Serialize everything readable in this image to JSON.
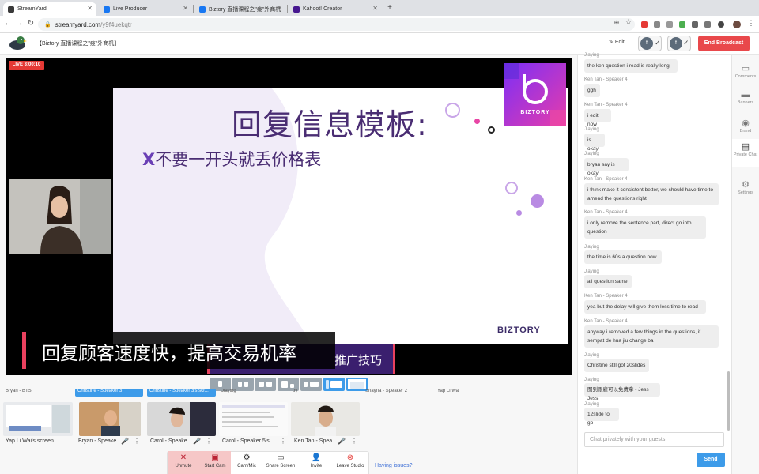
{
  "browser": {
    "tabs": [
      {
        "label": "StreamYard",
        "active": true,
        "color": "#3a3a3a"
      },
      {
        "label": "Live Producer",
        "active": false,
        "color": "#1877f2"
      },
      {
        "label": "Biztory 直播课程之\"疫\"外商机",
        "active": false,
        "color": "#1877f2"
      },
      {
        "label": "Kahoot! Creator",
        "active": false,
        "color": "#46178f"
      }
    ],
    "url_host": "streamyard.com",
    "url_path": "/y9f4uekqtr"
  },
  "app": {
    "title": "【Biztory 直播课程之\"疫\"外商机】",
    "edit_label": "Edit",
    "end_label": "End Broadcast",
    "accent": "#3d9be9",
    "end_color": "#e9484b"
  },
  "stage": {
    "live_label": "LIVE 3:00:10",
    "slide_title": "回复信息模板:",
    "slide_subtitle": "不要一开头就丢价格表",
    "slide_subtitle_mark": "X",
    "brand_name": "BIZTORY",
    "footer_brand": "BIZTORY",
    "caption_main": "回复顾客速度快，提高交易机率",
    "caption_sub": "推广技巧"
  },
  "backstage": {
    "names": [
      {
        "label": "Bryan - BTS",
        "onstage": false
      },
      {
        "label": "Christine - Speaker 3",
        "onstage": true
      },
      {
        "label": "Christine - Speaker 3's scr...",
        "onstage": true
      },
      {
        "label": "Jiaying",
        "onstage": false
      },
      {
        "label": "py",
        "onstage": false
      },
      {
        "label": "Shayna - Speaker 2",
        "onstage": false
      },
      {
        "label": "Yap Li Wai",
        "onstage": false
      }
    ],
    "thumbs": [
      {
        "label": "Yap Li Wai's screen"
      },
      {
        "label": "Bryan - Speake..."
      },
      {
        "label": "Carol - Speake..."
      },
      {
        "label": "Carol - Speaker 5's ..."
      },
      {
        "label": "Ken Tan - Spea..."
      }
    ]
  },
  "controls": {
    "unmute": "Unmute",
    "start_cam": "Start Cam",
    "cam_mic": "Cam/Mic",
    "share_screen": "Share Screen",
    "invite": "Invite",
    "leave": "Leave Studio",
    "issues": "Having issues?"
  },
  "chat": {
    "messages": [
      {
        "author": "Jiaying",
        "text": "the ken question i read is really long"
      },
      {
        "author": "Ken Tan - Speaker 4",
        "text": "ggh"
      },
      {
        "author": "Ken Tan - Speaker 4",
        "text": "i edit now"
      },
      {
        "author": "Jiaying",
        "text": "is okay"
      },
      {
        "author": "Jiaying",
        "text": "bryan say is okay"
      },
      {
        "author": "Ken Tan - Speaker 4",
        "text": "i think make it consistent better, we should have time to amend the questions right"
      },
      {
        "author": "Ken Tan - Speaker 4",
        "text": "i only remove the sentence part, direct go into question"
      },
      {
        "author": "Jiaying",
        "text": "the time is 60s a question now"
      },
      {
        "author": "Jiaying",
        "text": "all question same"
      },
      {
        "author": "Ken Tan - Speaker 4",
        "text": "yea but the delay will give them less time to read"
      },
      {
        "author": "Ken Tan - Speaker 4",
        "text": "anyway i removed a few things in the questions, if sempat de hua jiu change ba"
      },
      {
        "author": "Jiaying",
        "text": "Christine still got 20slides"
      },
      {
        "author": "Jiaying",
        "text": "图到跟雇可以免费拿 - Jess Jess"
      },
      {
        "author": "Jiaying",
        "text": "12slide to go"
      }
    ],
    "input_placeholder": "Chat privately with your guests",
    "send_label": "Send"
  },
  "rail": [
    {
      "label": "Comments",
      "icon": "comment-icon"
    },
    {
      "label": "Banners",
      "icon": "banner-icon"
    },
    {
      "label": "Brand",
      "icon": "palette-icon"
    },
    {
      "label": "Private Chat",
      "icon": "chat-icon"
    },
    {
      "label": "Settings",
      "icon": "gear-icon"
    }
  ]
}
